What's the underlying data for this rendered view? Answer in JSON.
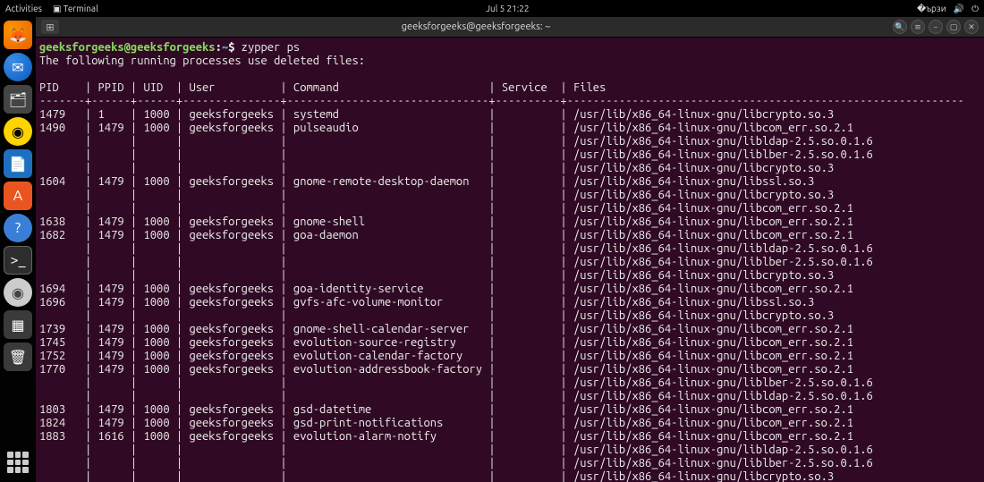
{
  "topbar": {
    "activities": "Activities",
    "terminal_label": "Terminal",
    "clock": "Jul 5  21:22"
  },
  "window": {
    "title": "geeksforgeeks@geeksforgeeks: ~"
  },
  "prompt": {
    "userhost": "geeksforgeeks@geeksforgeeks",
    "path": "~",
    "command": "zypper ps"
  },
  "msg": "The following running processes use deleted files:",
  "headers": {
    "pid": "PID",
    "ppid": "PPID",
    "uid": "UID",
    "user": "User",
    "command": "Command",
    "service": "Service",
    "files": "Files"
  },
  "rows": [
    {
      "pid": "1479",
      "ppid": "1",
      "uid": "1000",
      "user": "geeksforgeeks",
      "command": "systemd",
      "service": "",
      "file": "/usr/lib/x86_64-linux-gnu/libcrypto.so.3"
    },
    {
      "pid": "1490",
      "ppid": "1479",
      "uid": "1000",
      "user": "geeksforgeeks",
      "command": "pulseaudio",
      "service": "",
      "file": "/usr/lib/x86_64-linux-gnu/libcom_err.so.2.1"
    },
    {
      "pid": "",
      "ppid": "",
      "uid": "",
      "user": "",
      "command": "",
      "service": "",
      "file": "/usr/lib/x86_64-linux-gnu/libldap-2.5.so.0.1.6"
    },
    {
      "pid": "",
      "ppid": "",
      "uid": "",
      "user": "",
      "command": "",
      "service": "",
      "file": "/usr/lib/x86_64-linux-gnu/liblber-2.5.so.0.1.6"
    },
    {
      "pid": "",
      "ppid": "",
      "uid": "",
      "user": "",
      "command": "",
      "service": "",
      "file": "/usr/lib/x86_64-linux-gnu/libcrypto.so.3"
    },
    {
      "pid": "1604",
      "ppid": "1479",
      "uid": "1000",
      "user": "geeksforgeeks",
      "command": "gnome-remote-desktop-daemon",
      "service": "",
      "file": "/usr/lib/x86_64-linux-gnu/libssl.so.3"
    },
    {
      "pid": "",
      "ppid": "",
      "uid": "",
      "user": "",
      "command": "",
      "service": "",
      "file": "/usr/lib/x86_64-linux-gnu/libcrypto.so.3"
    },
    {
      "pid": "",
      "ppid": "",
      "uid": "",
      "user": "",
      "command": "",
      "service": "",
      "file": "/usr/lib/x86_64-linux-gnu/libcom_err.so.2.1"
    },
    {
      "pid": "1638",
      "ppid": "1479",
      "uid": "1000",
      "user": "geeksforgeeks",
      "command": "gnome-shell",
      "service": "",
      "file": "/usr/lib/x86_64-linux-gnu/libcom_err.so.2.1"
    },
    {
      "pid": "1682",
      "ppid": "1479",
      "uid": "1000",
      "user": "geeksforgeeks",
      "command": "goa-daemon",
      "service": "",
      "file": "/usr/lib/x86_64-linux-gnu/libcom_err.so.2.1"
    },
    {
      "pid": "",
      "ppid": "",
      "uid": "",
      "user": "",
      "command": "",
      "service": "",
      "file": "/usr/lib/x86_64-linux-gnu/libldap-2.5.so.0.1.6"
    },
    {
      "pid": "",
      "ppid": "",
      "uid": "",
      "user": "",
      "command": "",
      "service": "",
      "file": "/usr/lib/x86_64-linux-gnu/liblber-2.5.so.0.1.6"
    },
    {
      "pid": "",
      "ppid": "",
      "uid": "",
      "user": "",
      "command": "",
      "service": "",
      "file": "/usr/lib/x86_64-linux-gnu/libcrypto.so.3"
    },
    {
      "pid": "1694",
      "ppid": "1479",
      "uid": "1000",
      "user": "geeksforgeeks",
      "command": "goa-identity-service",
      "service": "",
      "file": "/usr/lib/x86_64-linux-gnu/libcom_err.so.2.1"
    },
    {
      "pid": "1696",
      "ppid": "1479",
      "uid": "1000",
      "user": "geeksforgeeks",
      "command": "gvfs-afc-volume-monitor",
      "service": "",
      "file": "/usr/lib/x86_64-linux-gnu/libssl.so.3"
    },
    {
      "pid": "",
      "ppid": "",
      "uid": "",
      "user": "",
      "command": "",
      "service": "",
      "file": "/usr/lib/x86_64-linux-gnu/libcrypto.so.3"
    },
    {
      "pid": "1739",
      "ppid": "1479",
      "uid": "1000",
      "user": "geeksforgeeks",
      "command": "gnome-shell-calendar-server",
      "service": "",
      "file": "/usr/lib/x86_64-linux-gnu/libcom_err.so.2.1"
    },
    {
      "pid": "1745",
      "ppid": "1479",
      "uid": "1000",
      "user": "geeksforgeeks",
      "command": "evolution-source-registry",
      "service": "",
      "file": "/usr/lib/x86_64-linux-gnu/libcom_err.so.2.1"
    },
    {
      "pid": "1752",
      "ppid": "1479",
      "uid": "1000",
      "user": "geeksforgeeks",
      "command": "evolution-calendar-factory",
      "service": "",
      "file": "/usr/lib/x86_64-linux-gnu/libcom_err.so.2.1"
    },
    {
      "pid": "1770",
      "ppid": "1479",
      "uid": "1000",
      "user": "geeksforgeeks",
      "command": "evolution-addressbook-factory",
      "service": "",
      "file": "/usr/lib/x86_64-linux-gnu/libcom_err.so.2.1"
    },
    {
      "pid": "",
      "ppid": "",
      "uid": "",
      "user": "",
      "command": "",
      "service": "",
      "file": "/usr/lib/x86_64-linux-gnu/liblber-2.5.so.0.1.6"
    },
    {
      "pid": "",
      "ppid": "",
      "uid": "",
      "user": "",
      "command": "",
      "service": "",
      "file": "/usr/lib/x86_64-linux-gnu/libldap-2.5.so.0.1.6"
    },
    {
      "pid": "1803",
      "ppid": "1479",
      "uid": "1000",
      "user": "geeksforgeeks",
      "command": "gsd-datetime",
      "service": "",
      "file": "/usr/lib/x86_64-linux-gnu/libcom_err.so.2.1"
    },
    {
      "pid": "1824",
      "ppid": "1479",
      "uid": "1000",
      "user": "geeksforgeeks",
      "command": "gsd-print-notifications",
      "service": "",
      "file": "/usr/lib/x86_64-linux-gnu/libcom_err.so.2.1"
    },
    {
      "pid": "1883",
      "ppid": "1616",
      "uid": "1000",
      "user": "geeksforgeeks",
      "command": "evolution-alarm-notify",
      "service": "",
      "file": "/usr/lib/x86_64-linux-gnu/libcom_err.so.2.1"
    },
    {
      "pid": "",
      "ppid": "",
      "uid": "",
      "user": "",
      "command": "",
      "service": "",
      "file": "/usr/lib/x86_64-linux-gnu/libldap-2.5.so.0.1.6"
    },
    {
      "pid": "",
      "ppid": "",
      "uid": "",
      "user": "",
      "command": "",
      "service": "",
      "file": "/usr/lib/x86_64-linux-gnu/liblber-2.5.so.0.1.6"
    },
    {
      "pid": "",
      "ppid": "",
      "uid": "",
      "user": "",
      "command": "",
      "service": "",
      "file": "/usr/lib/x86_64-linux-gnu/libcrypto.so.3"
    }
  ],
  "widths": {
    "pid": 7,
    "ppid": 5,
    "uid": 5,
    "user": 14,
    "command": 30,
    "service": 9
  }
}
